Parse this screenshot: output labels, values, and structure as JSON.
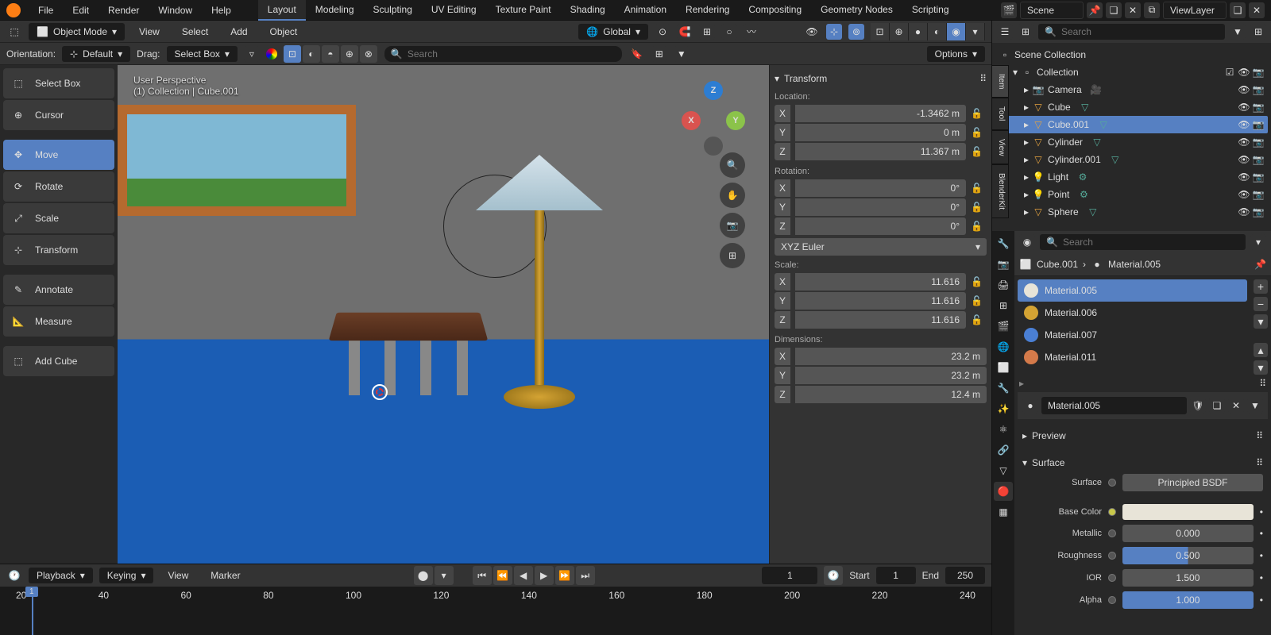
{
  "topMenu": [
    "File",
    "Edit",
    "Render",
    "Window",
    "Help"
  ],
  "workspaces": [
    "Layout",
    "Modeling",
    "Sculpting",
    "UV Editing",
    "Texture Paint",
    "Shading",
    "Animation",
    "Rendering",
    "Compositing",
    "Geometry Nodes",
    "Scripting"
  ],
  "activeWorkspace": 0,
  "scene": "Scene",
  "viewLayer": "ViewLayer",
  "viewportHeader": {
    "mode": "Object Mode",
    "menus": [
      "View",
      "Select",
      "Add",
      "Object"
    ],
    "orientation": "Global"
  },
  "orientRow": {
    "orientLabel": "Orientation:",
    "orientVal": "Default",
    "dragLabel": "Drag:",
    "dragVal": "Select Box",
    "searchPlaceholder": "Search",
    "options": "Options"
  },
  "tools": [
    "Select Box",
    "Cursor",
    "Move",
    "Rotate",
    "Scale",
    "Transform",
    "Annotate",
    "Measure",
    "Add Cube"
  ],
  "activeTool": 2,
  "overlay": {
    "l1": "User Perspective",
    "l2": "(1) Collection | Cube.001"
  },
  "transform": {
    "title": "Transform",
    "location": {
      "label": "Location:",
      "x": "-1.3462 m",
      "y": "0 m",
      "z": "11.367 m"
    },
    "rotation": {
      "label": "Rotation:",
      "x": "0°",
      "y": "0°",
      "z": "0°",
      "mode": "XYZ Euler"
    },
    "scale": {
      "label": "Scale:",
      "x": "11.616",
      "y": "11.616",
      "z": "11.616"
    },
    "dimensions": {
      "label": "Dimensions:",
      "x": "23.2 m",
      "y": "23.2 m",
      "z": "12.4 m"
    }
  },
  "nTabs": [
    "Item",
    "Tool",
    "View",
    "BlenderKit"
  ],
  "timeline": {
    "menus": [
      "Playback",
      "Keying",
      "View",
      "Marker"
    ],
    "current": "1",
    "startLabel": "Start",
    "start": "1",
    "endLabel": "End",
    "end": "250",
    "marks": [
      "20",
      "40",
      "60",
      "80",
      "100",
      "120",
      "140",
      "160",
      "180",
      "200",
      "220",
      "240"
    ]
  },
  "outliner": {
    "searchPlaceholder": "Search",
    "root": "Scene Collection",
    "collection": "Collection",
    "items": [
      {
        "name": "Camera",
        "type": "camera"
      },
      {
        "name": "Cube",
        "type": "mesh"
      },
      {
        "name": "Cube.001",
        "type": "mesh",
        "selected": true
      },
      {
        "name": "Cylinder",
        "type": "mesh"
      },
      {
        "name": "Cylinder.001",
        "type": "mesh"
      },
      {
        "name": "Light",
        "type": "light"
      },
      {
        "name": "Point",
        "type": "light"
      },
      {
        "name": "Sphere",
        "type": "mesh"
      }
    ]
  },
  "properties": {
    "searchPlaceholder": "Search",
    "breadcrumbObj": "Cube.001",
    "breadcrumbMat": "Material.005",
    "materials": [
      {
        "name": "Material.005",
        "color": "#e8e4d8"
      },
      {
        "name": "Material.006",
        "color": "#d4a333"
      },
      {
        "name": "Material.007",
        "color": "#4a7fd4"
      },
      {
        "name": "Material.011",
        "color": "#d47a4a"
      }
    ],
    "activeMat": 0,
    "matName": "Material.005",
    "previewLabel": "Preview",
    "surfaceLabel": "Surface",
    "surface": {
      "shaderLabel": "Surface",
      "shader": "Principled BSDF",
      "baseColorLabel": "Base Color",
      "metallicLabel": "Metallic",
      "metallic": "0.000",
      "roughnessLabel": "Roughness",
      "roughness": "0.500",
      "iorLabel": "IOR",
      "ior": "1.500",
      "alphaLabel": "Alpha",
      "alpha": "1.000"
    }
  }
}
